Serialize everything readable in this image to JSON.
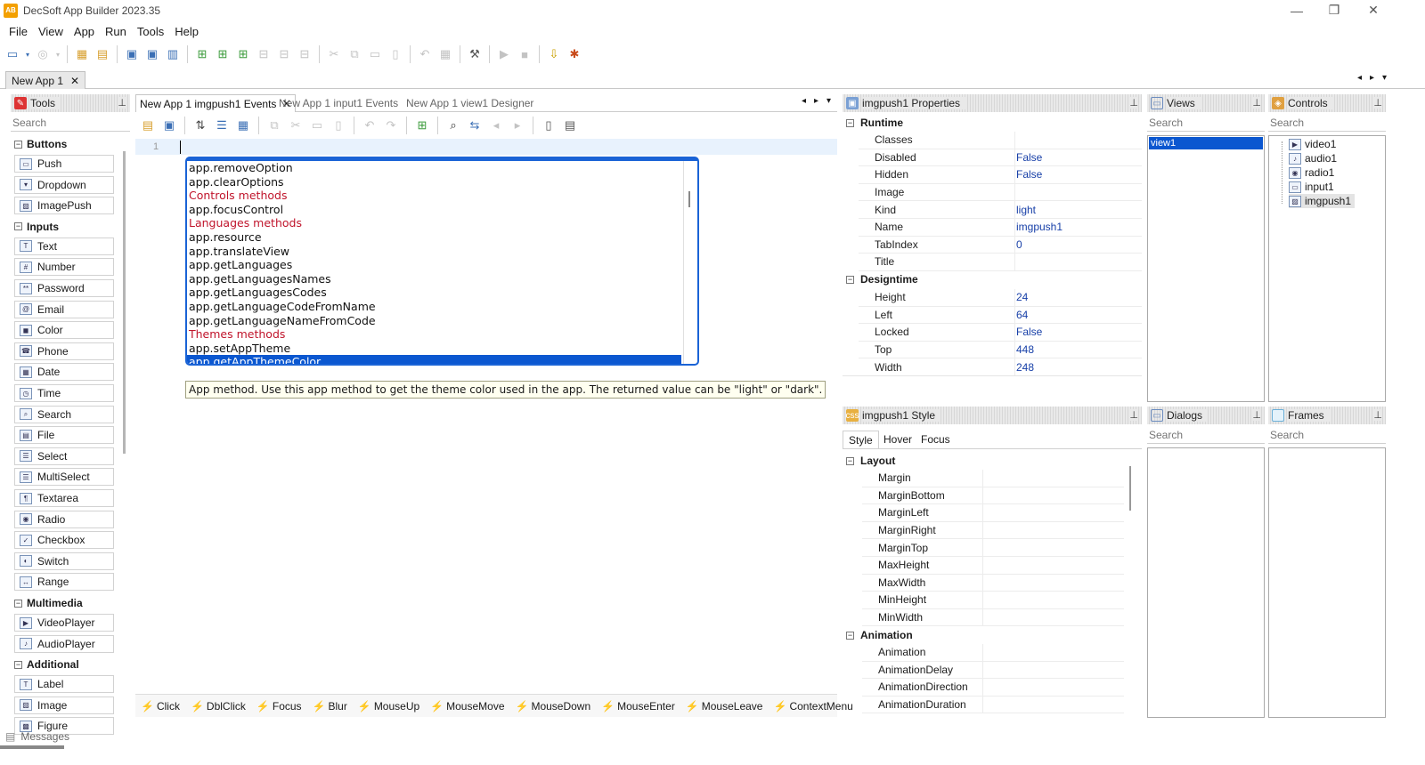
{
  "window": {
    "title": "DecSoft App Builder 2023.35",
    "app_icon": "AB"
  },
  "menu": [
    "File",
    "View",
    "App",
    "Run",
    "Tools",
    "Help"
  ],
  "doc_tab": {
    "label": "New App 1",
    "close": "✕"
  },
  "tools_panel": {
    "title": "Tools",
    "search_placeholder": "Search",
    "categories": [
      {
        "name": "Buttons",
        "items": [
          "Push",
          "Dropdown",
          "ImagePush"
        ]
      },
      {
        "name": "Inputs",
        "items": [
          "Text",
          "Number",
          "Password",
          "Email",
          "Color",
          "Phone",
          "Date",
          "Time",
          "Search",
          "File",
          "Select",
          "MultiSelect",
          "Textarea",
          "Radio",
          "Checkbox",
          "Switch",
          "Range"
        ]
      },
      {
        "name": "Multimedia",
        "items": [
          "VideoPlayer",
          "AudioPlayer"
        ]
      },
      {
        "name": "Additional",
        "items": [
          "Label",
          "Image",
          "Figure"
        ]
      }
    ]
  },
  "editor": {
    "tabs": [
      "New App 1 imgpush1 Events",
      "New App 1 input1 Events",
      "New App 1 view1 Designer"
    ],
    "line_number": "1",
    "autocomplete": [
      {
        "text": "app.removeOption",
        "kind": "method"
      },
      {
        "text": "app.clearOptions",
        "kind": "method"
      },
      {
        "text": "Controls methods",
        "kind": "category"
      },
      {
        "text": "app.focusControl",
        "kind": "method"
      },
      {
        "text": "Languages methods",
        "kind": "category"
      },
      {
        "text": "app.resource",
        "kind": "method"
      },
      {
        "text": "app.translateView",
        "kind": "method"
      },
      {
        "text": "app.getLanguages",
        "kind": "method"
      },
      {
        "text": "app.getLanguagesNames",
        "kind": "method"
      },
      {
        "text": "app.getLanguagesCodes",
        "kind": "method"
      },
      {
        "text": "app.getLanguageCodeFromName",
        "kind": "method"
      },
      {
        "text": "app.getLanguageNameFromCode",
        "kind": "method"
      },
      {
        "text": "Themes methods",
        "kind": "category"
      },
      {
        "text": "app.setAppTheme",
        "kind": "method"
      },
      {
        "text": "app.getAppThemeColor",
        "kind": "selected"
      }
    ],
    "tooltip": "App method. Use this app method to get the theme color used in the app. The returned value can be \"light\" or \"dark\".",
    "events": [
      "Click",
      "DblClick",
      "Focus",
      "Blur",
      "MouseUp",
      "MouseMove",
      "MouseDown",
      "MouseEnter",
      "MouseLeave",
      "ContextMenu"
    ]
  },
  "properties": {
    "title": "imgpush1 Properties",
    "runtime_label": "Runtime",
    "runtime": [
      {
        "k": "Classes",
        "v": ""
      },
      {
        "k": "Disabled",
        "v": "False"
      },
      {
        "k": "Hidden",
        "v": "False"
      },
      {
        "k": "Image",
        "v": ""
      },
      {
        "k": "Kind",
        "v": "light"
      },
      {
        "k": "Name",
        "v": "imgpush1"
      },
      {
        "k": "TabIndex",
        "v": "0"
      },
      {
        "k": "Title",
        "v": ""
      }
    ],
    "designtime_label": "Designtime",
    "designtime": [
      {
        "k": "Height",
        "v": "24"
      },
      {
        "k": "Left",
        "v": "64"
      },
      {
        "k": "Locked",
        "v": "False"
      },
      {
        "k": "Top",
        "v": "448"
      },
      {
        "k": "Width",
        "v": "248"
      }
    ]
  },
  "style": {
    "title": "imgpush1 Style",
    "tabs": [
      "Style",
      "Hover",
      "Focus"
    ],
    "layout_label": "Layout",
    "layout": [
      "Margin",
      "MarginBottom",
      "MarginLeft",
      "MarginRight",
      "MarginTop",
      "MaxHeight",
      "MaxWidth",
      "MinHeight",
      "MinWidth"
    ],
    "animation_label": "Animation",
    "animation": [
      "Animation",
      "AnimationDelay",
      "AnimationDirection",
      "AnimationDuration"
    ]
  },
  "views": {
    "title": "Views",
    "search_placeholder": "Search",
    "items": [
      "view1"
    ]
  },
  "controls": {
    "title": "Controls",
    "search_placeholder": "Search",
    "items": [
      "video1",
      "audio1",
      "radio1",
      "input1",
      "imgpush1"
    ]
  },
  "dialogs": {
    "title": "Dialogs",
    "search_placeholder": "Search"
  },
  "frames": {
    "title": "Frames",
    "search_placeholder": "Search"
  },
  "status": {
    "messages": "Messages"
  }
}
